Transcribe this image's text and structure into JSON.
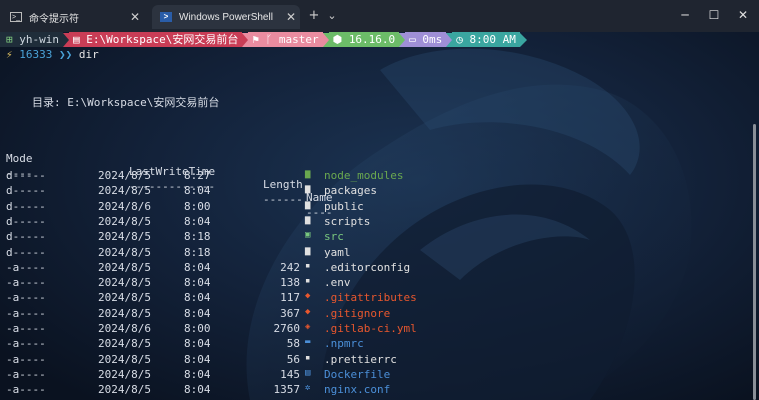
{
  "tabs": [
    {
      "label": "命令提示符",
      "icon": "cmd-icon"
    },
    {
      "label": "Windows PowerShell",
      "icon": "powershell-icon"
    }
  ],
  "titlebar": {
    "new_tab": "+",
    "dropdown": "⌄",
    "minimize": "─",
    "maximize": "☐",
    "close": "✕"
  },
  "prompt": {
    "user": "yh-win",
    "path": "E:\\Workspace\\安网交易前台",
    "git": "master",
    "node": "16.16.0",
    "duration": "0ms",
    "time": "8:00 AM",
    "pid": "16333",
    "command": "dir"
  },
  "directory_line": "目录: E:\\Workspace\\安网交易前台",
  "headers": {
    "mode": "Mode",
    "lastwrite": "LastWriteTime",
    "length": "Length",
    "name": "Name"
  },
  "underlines": {
    "mode": "----",
    "lastwrite": "-------------",
    "length": "------",
    "name": "----"
  },
  "rows": [
    {
      "mode": "d-----",
      "date": "2024/8/5",
      "time": "8:27",
      "length": "",
      "name": "node_modules",
      "icon": "folder-green-icon",
      "color": "#6aa84f"
    },
    {
      "mode": "d-----",
      "date": "2024/8/5",
      "time": "8:04",
      "length": "",
      "name": "packages",
      "icon": "folder-icon",
      "color": "#e0e0e0"
    },
    {
      "mode": "d-----",
      "date": "2024/8/6",
      "time": "8:00",
      "length": "",
      "name": "public",
      "icon": "folder-icon",
      "color": "#e0e0e0"
    },
    {
      "mode": "d-----",
      "date": "2024/8/5",
      "time": "8:04",
      "length": "",
      "name": "scripts",
      "icon": "folder-icon",
      "color": "#e0e0e0"
    },
    {
      "mode": "d-----",
      "date": "2024/8/5",
      "time": "8:18",
      "length": "",
      "name": "src",
      "icon": "terminal-folder-icon",
      "color": "#79c77e"
    },
    {
      "mode": "d-----",
      "date": "2024/8/5",
      "time": "8:18",
      "length": "",
      "name": "yaml",
      "icon": "folder-icon",
      "color": "#e0e0e0"
    },
    {
      "mode": "-a----",
      "date": "2024/8/5",
      "time": "8:04",
      "length": "242",
      "name": ".editorconfig",
      "icon": "file-icon",
      "color": "#e0e0e0"
    },
    {
      "mode": "-a----",
      "date": "2024/8/5",
      "time": "8:04",
      "length": "138",
      "name": ".env",
      "icon": "file-icon",
      "color": "#e0e0e0"
    },
    {
      "mode": "-a----",
      "date": "2024/8/5",
      "time": "8:04",
      "length": "117",
      "name": ".gitattributes",
      "icon": "git-icon",
      "color": "#e8572e"
    },
    {
      "mode": "-a----",
      "date": "2024/8/5",
      "time": "8:04",
      "length": "367",
      "name": ".gitignore",
      "icon": "git-icon",
      "color": "#e8572e"
    },
    {
      "mode": "-a----",
      "date": "2024/8/6",
      "time": "8:00",
      "length": "2760",
      "name": ".gitlab-ci.yml",
      "icon": "gitlab-icon",
      "color": "#e8572e"
    },
    {
      "mode": "-a----",
      "date": "2024/8/5",
      "time": "8:04",
      "length": "58",
      "name": ".npmrc",
      "icon": "npm-icon",
      "color": "#4b8fd8"
    },
    {
      "mode": "-a----",
      "date": "2024/8/5",
      "time": "8:04",
      "length": "56",
      "name": ".prettierrc",
      "icon": "file-icon",
      "color": "#e0e0e0"
    },
    {
      "mode": "-a----",
      "date": "2024/8/5",
      "time": "8:04",
      "length": "145",
      "name": "Dockerfile",
      "icon": "docker-icon",
      "color": "#4b8fd8"
    },
    {
      "mode": "-a----",
      "date": "2024/8/5",
      "time": "8:04",
      "length": "1357",
      "name": "nginx.conf",
      "icon": "gear-icon",
      "color": "#4b8fd8"
    }
  ],
  "colors": {
    "titlebar": "#1f2530",
    "seg_user": "#1f2d3a",
    "seg_path": "#c93d56",
    "seg_git": "#e98ca0",
    "seg_node": "#6cbc68",
    "seg_duration": "#9f8fd6",
    "seg_time": "#3aa6a0"
  }
}
